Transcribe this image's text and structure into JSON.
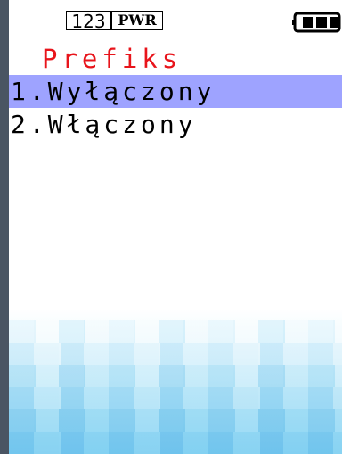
{
  "status_bar": {
    "input_mode": "123",
    "power_label": "PWR",
    "battery_icon": "battery-icon"
  },
  "screen": {
    "title": "Prefiks",
    "menu_items": [
      {
        "label": "1.Wyłączony",
        "selected": true
      },
      {
        "label": "2.Włączony",
        "selected": false
      }
    ]
  },
  "colors": {
    "title": "#e8141b",
    "selection": "#9ea3ff",
    "bezel": "#4a5563"
  }
}
